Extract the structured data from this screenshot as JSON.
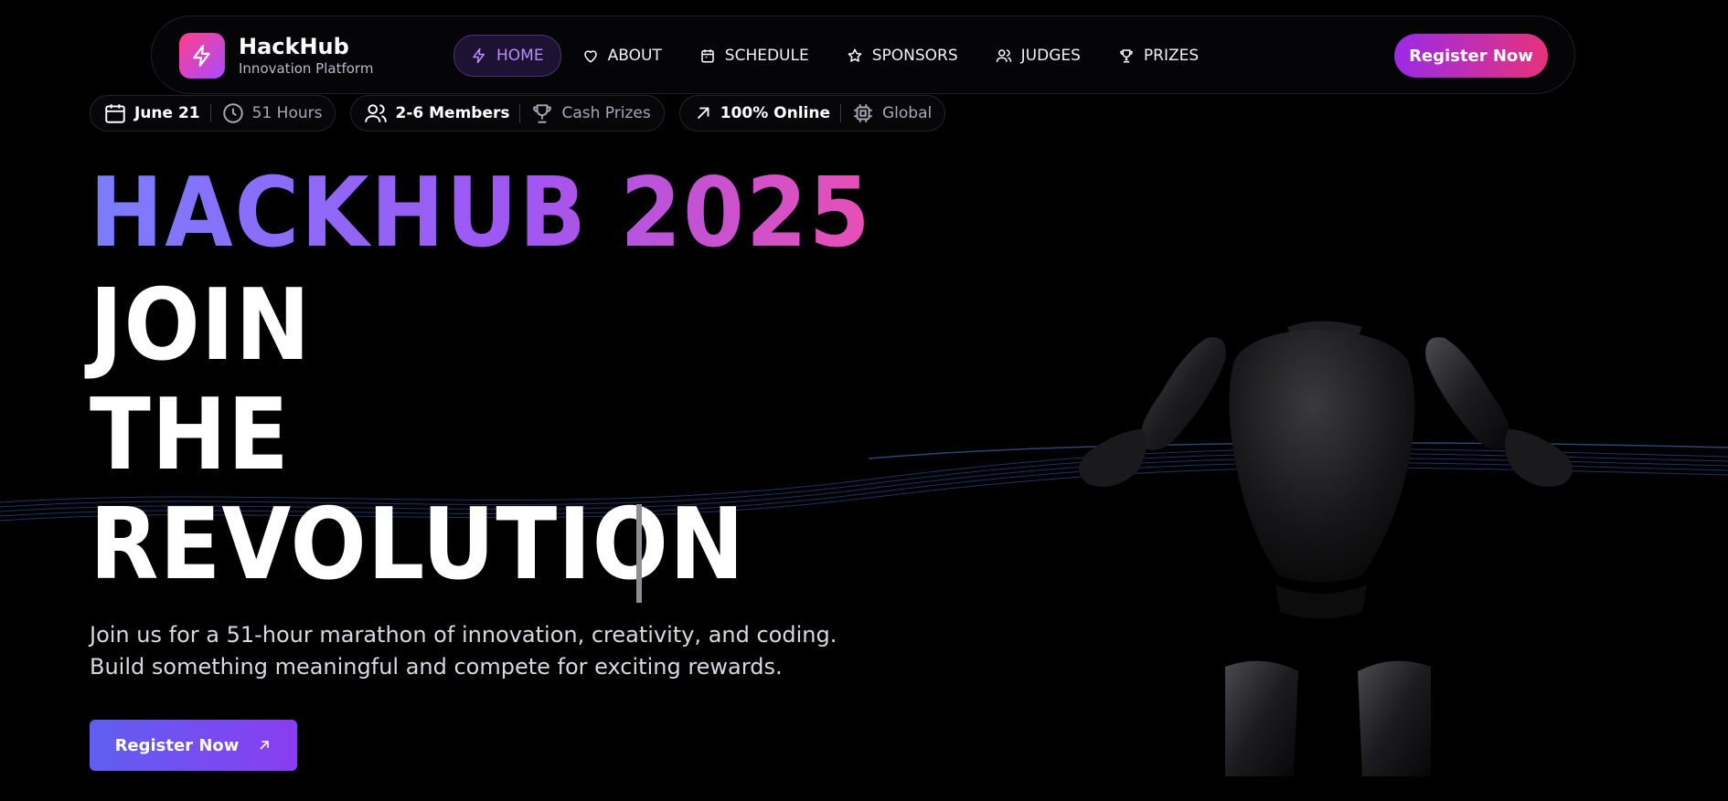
{
  "nav": {
    "brand_name": "HackHub",
    "brand_sub": "Innovation Platform",
    "items": [
      {
        "label": "HOME",
        "icon": "bolt-icon",
        "active": true
      },
      {
        "label": "ABOUT",
        "icon": "heart-icon"
      },
      {
        "label": "SCHEDULE",
        "icon": "calendar-icon"
      },
      {
        "label": "SPONSORS",
        "icon": "star-icon"
      },
      {
        "label": "JUDGES",
        "icon": "users-icon"
      },
      {
        "label": "PRIZES",
        "icon": "trophy-icon"
      }
    ],
    "cta": "Register Now"
  },
  "pills": [
    {
      "a": "June 21",
      "a_icon": "calendar-icon",
      "b": "51 Hours",
      "b_icon": "clock-icon"
    },
    {
      "a": "2-6 Members",
      "a_icon": "users-icon",
      "b": "Cash Prizes",
      "b_icon": "trophy-icon"
    },
    {
      "a": "100% Online",
      "a_icon": "arrow-up-right-icon",
      "b": "Global",
      "b_icon": "cpu-icon"
    }
  ],
  "hero": {
    "title": "HACKHUB 2025",
    "line1": "JOIN",
    "line2": "THE",
    "line3": "REVOLUTION",
    "description": "Join us for a 51-hour marathon of innovation, creativity, and coding. Build something meaningful and compete for exciting rewards.",
    "cta": "Register Now"
  },
  "colors": {
    "accent_pink": "#e7327c",
    "accent_purple": "#9b2ae6",
    "accent_blue": "#5f5ff0",
    "background": "#000000"
  }
}
